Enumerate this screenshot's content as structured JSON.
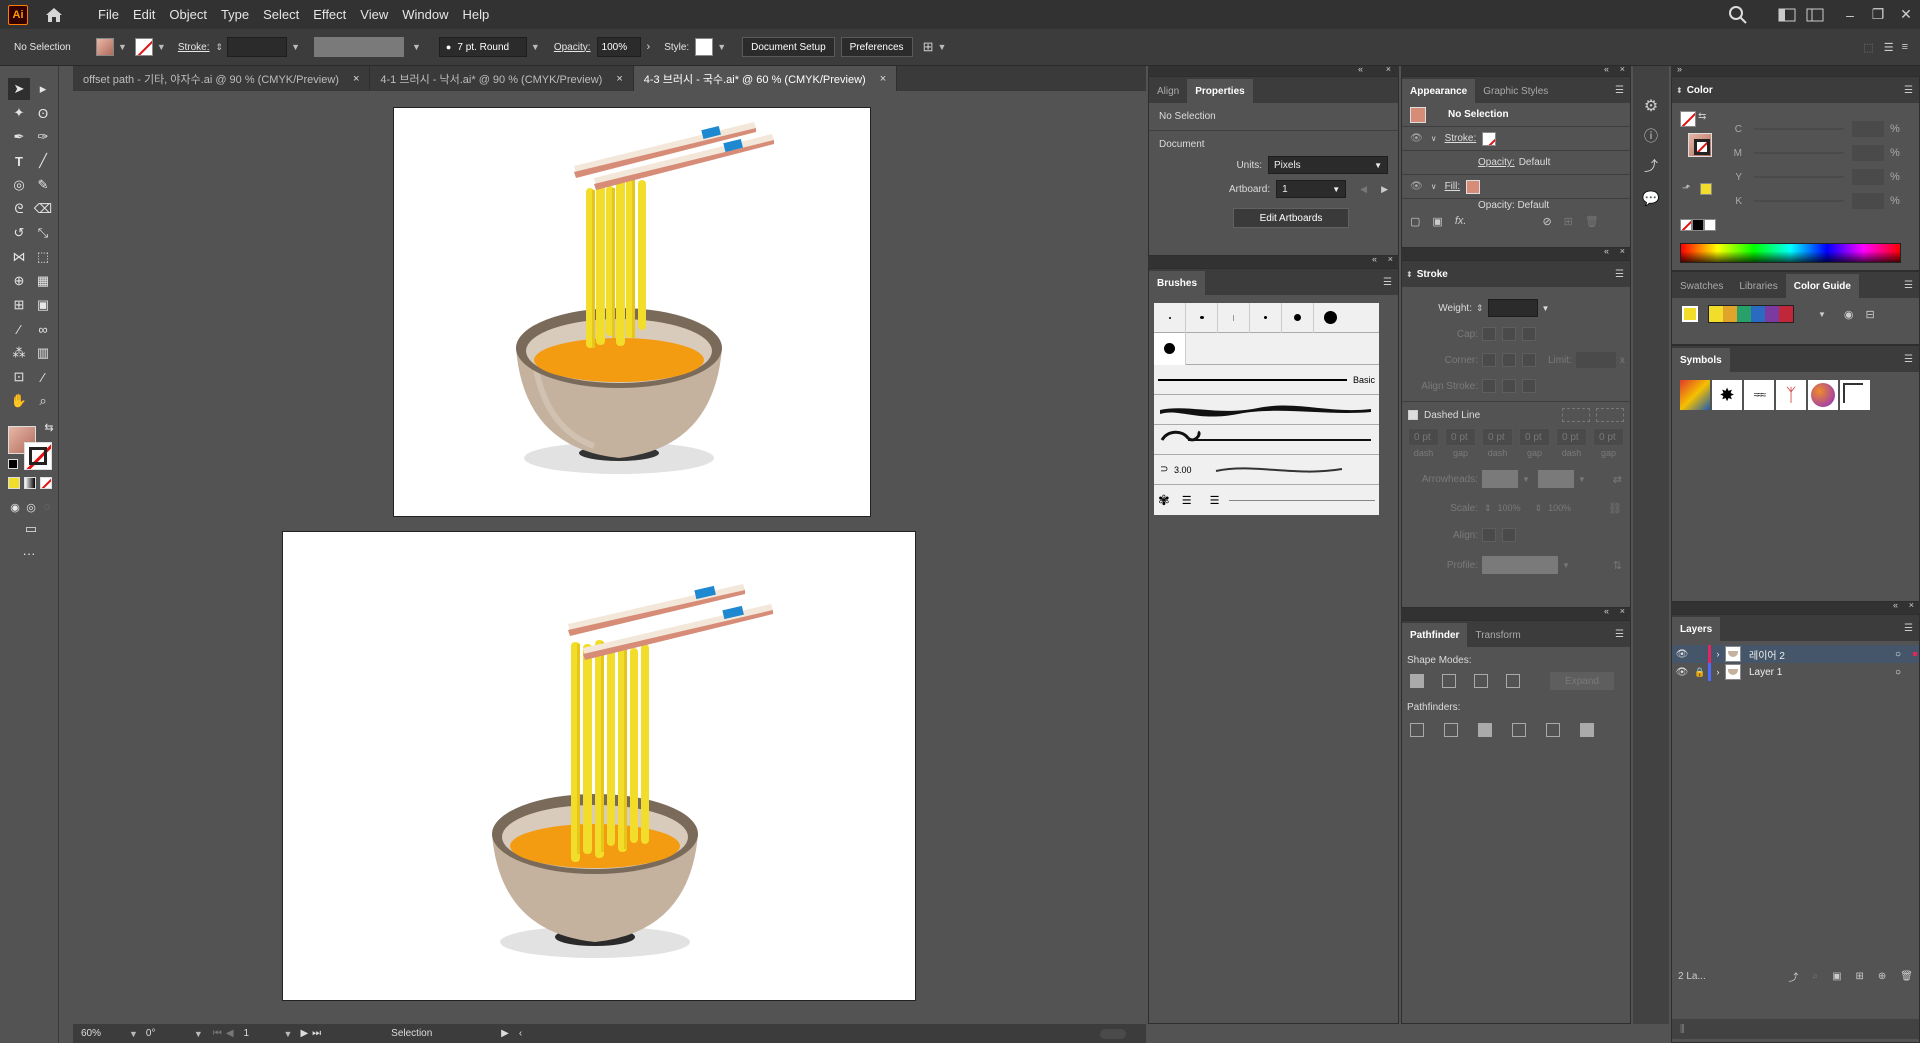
{
  "app": {
    "logo_text": "Ai"
  },
  "menu": [
    "File",
    "Edit",
    "Object",
    "Type",
    "Select",
    "Effect",
    "View",
    "Window",
    "Help"
  ],
  "control_bar": {
    "selection_text": "No Selection",
    "stroke_label": "Stroke:",
    "brush_label": "7 pt. Round",
    "opacity_label": "Opacity:",
    "opacity_value": "100%",
    "style_label": "Style:",
    "document_setup": "Document Setup",
    "preferences": "Preferences"
  },
  "tabs": [
    {
      "label": "offset path - 기타, 야자수.ai @ 90 % (CMYK/Preview)"
    },
    {
      "label": "4-1 브러시 - 낙서.ai* @ 90 % (CMYK/Preview)"
    },
    {
      "label": "4-3 브러시 - 국수.ai* @ 60 % (CMYK/Preview)"
    }
  ],
  "tab_close": "×",
  "status": {
    "zoom": "60%",
    "rotate": "0°",
    "artboard": "1",
    "tool": "Selection"
  },
  "properties_panel": {
    "tab_align": "Align",
    "tab_properties": "Properties",
    "no_selection": "No Selection",
    "document_label": "Document",
    "units_label": "Units:",
    "units_value": "Pixels",
    "artboard_label": "Artboard:",
    "artboard_value": "1",
    "edit_artboards": "Edit Artboards"
  },
  "appearance_panel": {
    "tab_appearance": "Appearance",
    "tab_graphic_styles": "Graphic Styles",
    "title": "No Selection",
    "stroke_label": "Stroke:",
    "opacity_label": "Opacity:",
    "opacity_value": "Default",
    "fill_label": "Fill:",
    "opacity2": "Opacity: Default",
    "fx": "fx."
  },
  "brushes_panel": {
    "title": "Brushes",
    "basic_label": "Basic",
    "size_label": "3.00"
  },
  "stroke_panel": {
    "title": "Stroke",
    "weight_label": "Weight:",
    "cap_label": "Cap:",
    "corner_label": "Corner:",
    "limit_label": "Limit:",
    "limit_x": "x",
    "align_label": "Align Stroke:",
    "dashed_label": "Dashed Line",
    "dash_values": [
      "0 pt",
      "0 pt",
      "0 pt",
      "0 pt",
      "0 pt",
      "0 pt"
    ],
    "dash_labels": [
      "dash",
      "gap",
      "dash",
      "gap",
      "dash",
      "gap"
    ],
    "arrowheads_label": "Arrowheads:",
    "scale_label": "Scale:",
    "scale1": "100%",
    "scale2": "100%",
    "align2_label": "Align:",
    "profile_label": "Profile:"
  },
  "pathfinder_panel": {
    "tab_pathfinder": "Pathfinder",
    "tab_transform": "Transform",
    "shape_modes_label": "Shape Modes:",
    "expand": "Expand",
    "pathfinders_label": "Pathfinders:"
  },
  "color_panel": {
    "title": "Color",
    "channels": [
      "C",
      "M",
      "Y",
      "K"
    ],
    "percent": "%"
  },
  "swatches_panel": {
    "tab_swatches": "Swatches",
    "tab_libraries": "Libraries",
    "tab_color_guide": "Color Guide"
  },
  "symbols_panel": {
    "title": "Symbols"
  },
  "layers_panel": {
    "title": "Layers",
    "layers": [
      {
        "name": "레이어 2"
      },
      {
        "name": "Layer 1"
      }
    ],
    "footer_count": "2 La..."
  },
  "colors": {
    "accent_blue": "#1e88d0",
    "noodle_yellow": "#f2dd2a",
    "broth_orange": "#f39c12",
    "bowl_tan": "#c4b29f",
    "layer2_color": "#e2265d",
    "layer1_color": "#4f6bff"
  }
}
